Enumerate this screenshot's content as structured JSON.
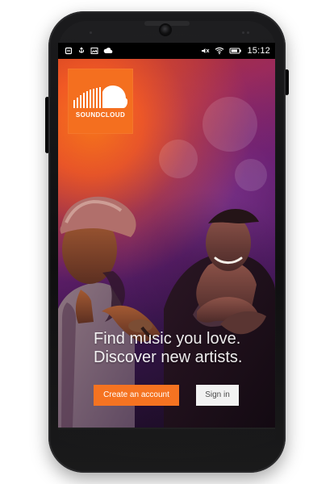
{
  "device": {
    "status_bar": {
      "time": "15:12",
      "left_icons": [
        "notification-icon",
        "usb-icon",
        "image-icon",
        "cloud-icon"
      ],
      "right_icons": [
        "mute-icon",
        "wifi-icon",
        "battery-icon"
      ]
    }
  },
  "brand": {
    "logo_text": "SOUNDCLOUD",
    "accent": "#f57321"
  },
  "hero": {
    "headline_lines": [
      "Find music you love.",
      "Discover new artists."
    ]
  },
  "actions": {
    "create_account_label": "Create an account",
    "sign_in_label": "Sign in"
  }
}
